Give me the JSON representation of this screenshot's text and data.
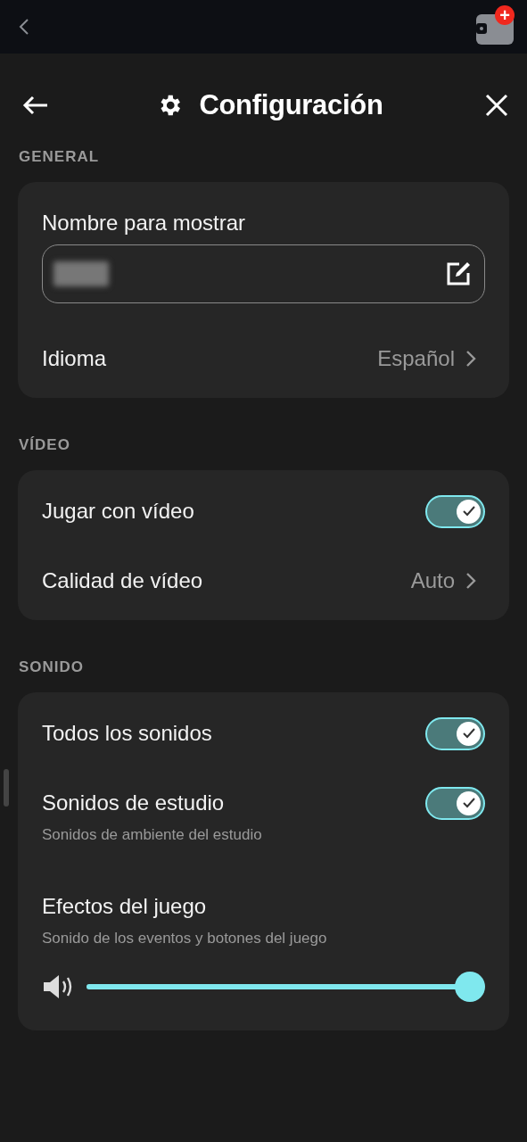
{
  "top_bar": {
    "wallet_badge": "+"
  },
  "header": {
    "title": "Configuración"
  },
  "sections": [
    {
      "title": "GENERAL",
      "rows": [
        {
          "kind": "field",
          "label": "Nombre para mostrar"
        },
        {
          "kind": "link",
          "label": "Idioma",
          "value": "Español"
        }
      ]
    },
    {
      "title": "VÍDEO",
      "rows": [
        {
          "kind": "toggle",
          "label": "Jugar con vídeo",
          "on": true
        },
        {
          "kind": "link",
          "label": "Calidad de vídeo",
          "value": "Auto"
        }
      ]
    },
    {
      "title": "SONIDO",
      "rows": [
        {
          "kind": "toggle",
          "label": "Todos los sonidos",
          "on": true
        },
        {
          "kind": "toggle",
          "label": "Sonidos de estudio",
          "description": "Sonidos de ambiente del estudio",
          "on": true
        },
        {
          "kind": "slider",
          "label": "Efectos del juego",
          "description": "Sonido de los eventos y botones del juego",
          "level": 1
        }
      ]
    }
  ]
}
